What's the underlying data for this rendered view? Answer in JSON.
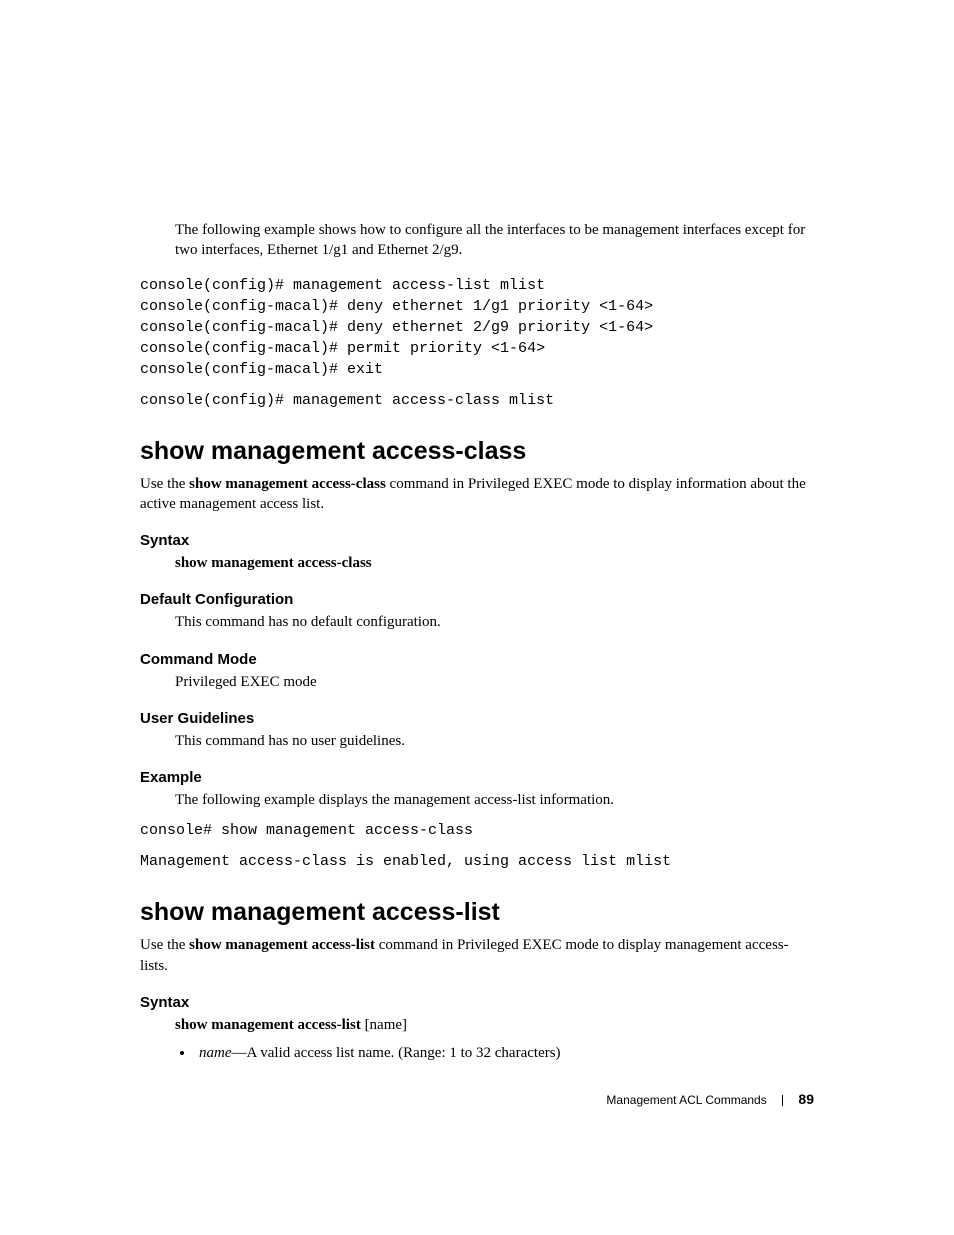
{
  "intro": "The following example shows how to configure all the interfaces to be management interfaces except for two interfaces, Ethernet 1/g1 and Ethernet 2/g9.",
  "code0": "console(config)# management access-list mlist\nconsole(config-macal)# deny ethernet 1/g1 priority <1-64>\nconsole(config-macal)# deny ethernet 2/g9 priority <1-64>\nconsole(config-macal)# permit priority <1-64>\nconsole(config-macal)# exit",
  "code0b": "console(config)# management access-class mlist",
  "sec1": {
    "title": "show management access-class",
    "desc_pre": "Use the ",
    "desc_bold": "show management access-class",
    "desc_post": " command in Privileged EXEC mode to display information about the active management access list.",
    "syntax_h": "Syntax",
    "syntax_body": "show management access-class",
    "defcfg_h": "Default Configuration",
    "defcfg_body": "This command has no default configuration.",
    "mode_h": "Command Mode",
    "mode_body": "Privileged EXEC mode",
    "guide_h": "User Guidelines",
    "guide_body": "This command has no user guidelines.",
    "ex_h": "Example",
    "ex_body": "The following example displays the management access-list information.",
    "ex_code1": "console# show management access-class",
    "ex_code2": "Management access-class is enabled, using access list mlist"
  },
  "sec2": {
    "title": "show management access-list",
    "desc_pre": "Use the ",
    "desc_bold": "show management access-list",
    "desc_post": " command in Privileged EXEC mode to display management access-lists.",
    "syntax_h": "Syntax",
    "syntax_body_bold": "show management access-list ",
    "syntax_body_arg": "[name]",
    "bullet_name": "name",
    "bullet_rest": "—A valid access list name. (Range: 1 to 32 characters)"
  },
  "footer": {
    "section": "Management ACL Commands",
    "page": "89"
  }
}
